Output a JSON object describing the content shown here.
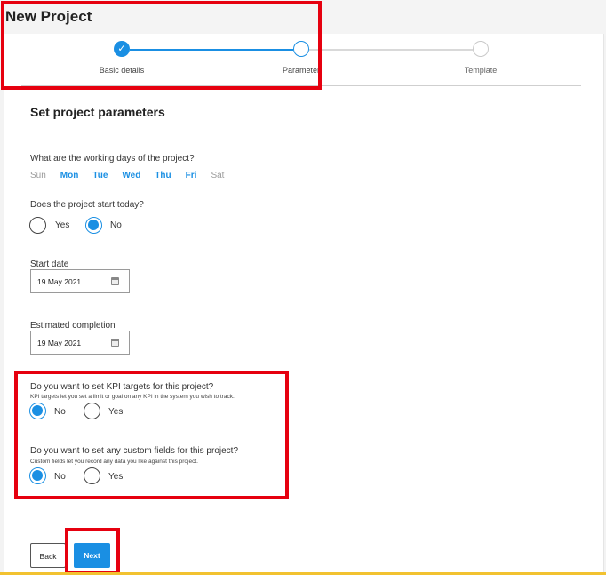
{
  "header": {
    "title": "New Project"
  },
  "stepper": {
    "steps": [
      {
        "label": "Basic details"
      },
      {
        "label": "Parameter"
      },
      {
        "label": "Template"
      }
    ],
    "check_glyph": "✓"
  },
  "form": {
    "section_title": "Set project parameters",
    "working_days": {
      "question": "What are the working days of the project?",
      "days": [
        {
          "label": "Sun",
          "selected": false
        },
        {
          "label": "Mon",
          "selected": true
        },
        {
          "label": "Tue",
          "selected": true
        },
        {
          "label": "Wed",
          "selected": true
        },
        {
          "label": "Thu",
          "selected": true
        },
        {
          "label": "Fri",
          "selected": true
        },
        {
          "label": "Sat",
          "selected": false
        }
      ]
    },
    "start_today": {
      "question": "Does the project start today?",
      "yes": "Yes",
      "no": "No",
      "selected": "No"
    },
    "start_date": {
      "label": "Start date",
      "value": "19 May 2021"
    },
    "estimated_completion": {
      "label": "Estimated completion",
      "value": "19 May 2021"
    },
    "kpi": {
      "question": "Do you want to set KPI targets for this project?",
      "help": "KPI targets let you set a limit or goal on any KPI in the system you wish to track.",
      "no": "No",
      "yes": "Yes",
      "selected": "No"
    },
    "custom_fields": {
      "question": "Do you want to set any custom fields for this project?",
      "help": "Custom fields let you record any data you like against this project.",
      "no": "No",
      "yes": "Yes",
      "selected": "No"
    }
  },
  "buttons": {
    "back": "Back",
    "next": "Next"
  },
  "colors": {
    "accent": "#1a8fe3",
    "highlight": "#e6000f"
  }
}
